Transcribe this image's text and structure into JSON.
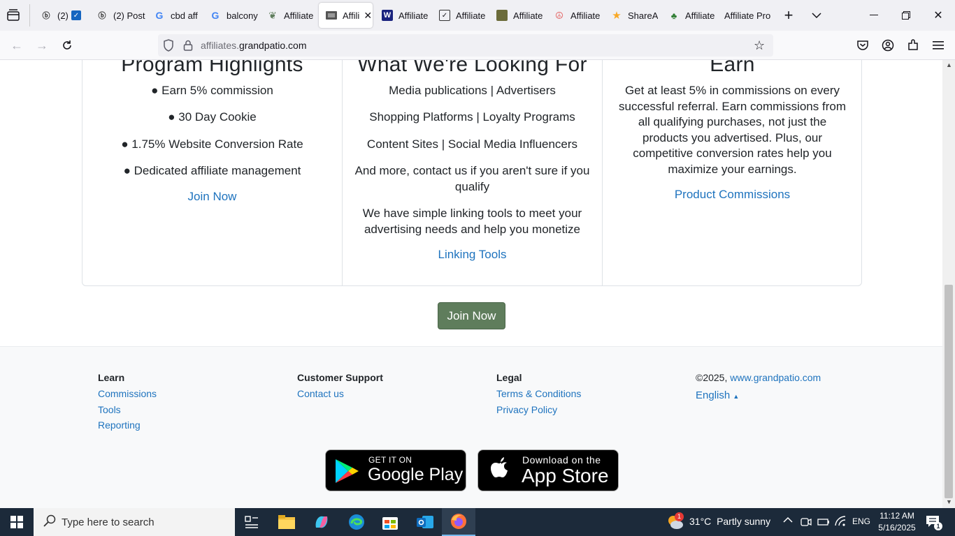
{
  "browser": {
    "tabs": [
      {
        "label": "(2)",
        "icon": "bing-icon"
      },
      {
        "label": "(2) Post",
        "icon": "bing-icon"
      },
      {
        "label": "cbd aff",
        "icon": "google-icon"
      },
      {
        "label": "balcony",
        "icon": "google-icon"
      },
      {
        "label": "Affiliate",
        "icon": "leaf-icon"
      },
      {
        "label": "Affili",
        "icon": "site-icon",
        "active": true
      },
      {
        "label": "Affiliate",
        "icon": "w-icon"
      },
      {
        "label": "Affiliate",
        "icon": "check-icon"
      },
      {
        "label": "Affiliate",
        "icon": "green-square-icon"
      },
      {
        "label": "Affiliate",
        "icon": "peace-icon"
      },
      {
        "label": "ShareA",
        "icon": "star-icon"
      },
      {
        "label": "Affiliate",
        "icon": "palm-icon"
      },
      {
        "label": "Affiliate Pro",
        "icon": "none"
      }
    ],
    "url_dim": "affiliates.",
    "url_main": "grandpatio.com"
  },
  "content": {
    "col1": {
      "heading": "Program Highlights",
      "bullets": [
        "● Earn 5% commission",
        "● 30 Day Cookie",
        "● 1.75% Website Conversion Rate",
        "● Dedicated affiliate management"
      ],
      "link": "Join Now"
    },
    "col2": {
      "heading": "What We're Looking For",
      "lines": [
        "Media publications | Advertisers",
        "Shopping Platforms | Loyalty Programs",
        "Content Sites | Social Media Influencers"
      ],
      "more_1": "And more, contact us if you aren't sure if you",
      "more_2": "qualify",
      "tools_1": "We have simple linking tools to meet your",
      "tools_2": "advertising needs and help you monetize",
      "link": "Linking Tools"
    },
    "col3": {
      "heading": "Earn",
      "text": [
        "Get at least 5% in commissions on every",
        "successful referral. Earn commissions from",
        "all qualifying purchases, not just the",
        "products you advertised. Plus, our",
        "competitive conversion rates help you",
        "maximize your earnings."
      ],
      "link": "Product Commissions"
    },
    "join_button": "Join Now"
  },
  "footer": {
    "learn": {
      "title": "Learn",
      "items": [
        "Commissions",
        "Tools",
        "Reporting"
      ]
    },
    "support": {
      "title": "Customer Support",
      "items": [
        "Contact us"
      ]
    },
    "legal": {
      "title": "Legal",
      "items": [
        "Terms & Conditions",
        "Privacy Policy"
      ]
    },
    "copyright_prefix": "©2025, ",
    "copyright_link": "www.grandpatio.com",
    "language": "English",
    "google_play_small": "GET IT ON",
    "google_play_big": "Google Play",
    "app_store_small": "Download on the",
    "app_store_big": "App Store"
  },
  "taskbar": {
    "search_placeholder": "Type here to search",
    "weather_temp": "31°C",
    "weather_desc": "Partly sunny",
    "weather_badge": "1",
    "lang": "ENG",
    "time": "11:12 AM",
    "date": "5/16/2025",
    "notification_count": "1"
  },
  "colors": {
    "link": "#1e73be",
    "button": "#5f7d5c",
    "taskbar": "#1c2a3a"
  }
}
